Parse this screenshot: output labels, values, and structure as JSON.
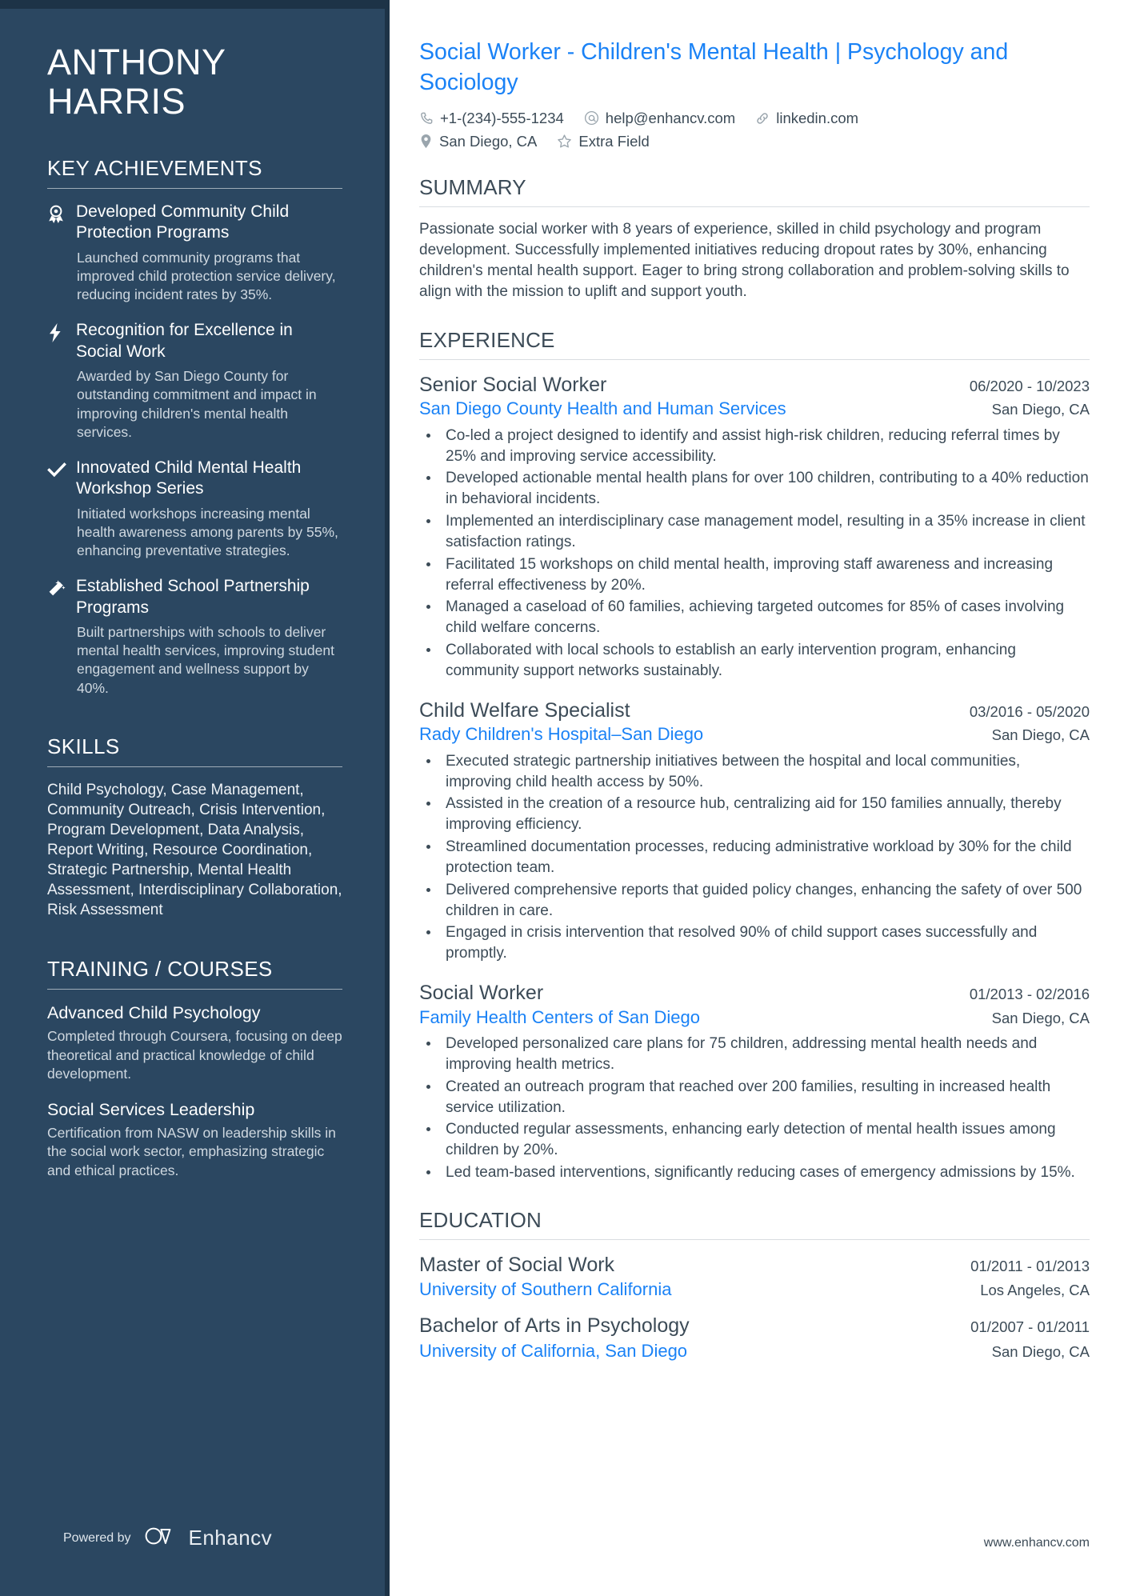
{
  "sidebar": {
    "name_first": "ANTHONY",
    "name_last": "HARRIS",
    "achievements_heading": "KEY ACHIEVEMENTS",
    "achievements": [
      {
        "icon": "award-ribbon-icon",
        "title": "Developed Community Child Protection Programs",
        "description": "Launched community programs that improved child protection service delivery, reducing incident rates by 35%."
      },
      {
        "icon": "lightning-bolt-icon",
        "title": "Recognition for Excellence in Social Work",
        "description": "Awarded by San Diego County for outstanding commitment and impact in improving children's mental health services."
      },
      {
        "icon": "checkmark-icon",
        "title": "Innovated Child Mental Health Workshop Series",
        "description": "Initiated workshops increasing mental health awareness among parents by 55%, enhancing preventative strategies."
      },
      {
        "icon": "magic-wand-icon",
        "title": "Established School Partnership Programs",
        "description": "Built partnerships with schools to deliver mental health services, improving student engagement and wellness support by 40%."
      }
    ],
    "skills_heading": "SKILLS",
    "skills_text": "Child Psychology, Case Management, Community Outreach, Crisis Intervention, Program Development, Data Analysis, Report Writing, Resource Coordination, Strategic Partnership, Mental Health Assessment, Interdisciplinary Collaboration, Risk Assessment",
    "training_heading": "TRAINING / COURSES",
    "courses": [
      {
        "title": "Advanced Child Psychology",
        "description": "Completed through Coursera, focusing on deep theoretical and practical knowledge of child development."
      },
      {
        "title": "Social Services Leadership",
        "description": "Certification from NASW on leadership skills in the social work sector, emphasizing strategic and ethical practices."
      }
    ],
    "powered_by_label": "Powered by",
    "brand_name": "Enhancv"
  },
  "header": {
    "headline": "Social Worker - Children's Mental Health | Psychology and Sociology",
    "contacts": [
      {
        "icon": "phone-icon",
        "text": "+1-(234)-555-1234"
      },
      {
        "icon": "at-email-icon",
        "text": "help@enhancv.com"
      },
      {
        "icon": "link-icon",
        "text": "linkedin.com"
      },
      {
        "icon": "map-pin-icon",
        "text": "San Diego, CA"
      },
      {
        "icon": "star-icon",
        "text": "Extra Field"
      }
    ]
  },
  "summary": {
    "heading": "SUMMARY",
    "text": "Passionate social worker with 8 years of experience, skilled in child psychology and program development. Successfully implemented initiatives reducing dropout rates by 30%, enhancing children's mental health support. Eager to bring strong collaboration and problem-solving skills to align with the mission to uplift and support youth."
  },
  "experience": {
    "heading": "EXPERIENCE",
    "jobs": [
      {
        "title": "Senior Social Worker",
        "date": "06/2020 - 10/2023",
        "organization": "San Diego County Health and Human Services",
        "location": "San Diego, CA",
        "bullets": [
          "Co-led a project designed to identify and assist high-risk children, reducing referral times by 25% and improving service accessibility.",
          "Developed actionable mental health plans for over 100 children, contributing to a 40% reduction in behavioral incidents.",
          "Implemented an interdisciplinary case management model, resulting in a 35% increase in client satisfaction ratings.",
          "Facilitated 15 workshops on child mental health, improving staff awareness and increasing referral effectiveness by 20%.",
          "Managed a caseload of 60 families, achieving targeted outcomes for 85% of cases involving child welfare concerns.",
          "Collaborated with local schools to establish an early intervention program, enhancing community support networks sustainably."
        ]
      },
      {
        "title": "Child Welfare Specialist",
        "date": "03/2016 - 05/2020",
        "organization": "Rady Children's Hospital–San Diego",
        "location": "San Diego, CA",
        "bullets": [
          "Executed strategic partnership initiatives between the hospital and local communities, improving child health access by 50%.",
          "Assisted in the creation of a resource hub, centralizing aid for 150 families annually, thereby improving efficiency.",
          "Streamlined documentation processes, reducing administrative workload by 30% for the child protection team.",
          "Delivered comprehensive reports that guided policy changes, enhancing the safety of over 500 children in care.",
          "Engaged in crisis intervention that resolved 90% of child support cases successfully and promptly."
        ]
      },
      {
        "title": "Social Worker",
        "date": "01/2013 - 02/2016",
        "organization": "Family Health Centers of San Diego",
        "location": "San Diego, CA",
        "bullets": [
          "Developed personalized care plans for 75 children, addressing mental health needs and improving health metrics.",
          "Created an outreach program that reached over 200 families, resulting in increased health service utilization.",
          "Conducted regular assessments, enhancing early detection of mental health issues among children by 20%.",
          "Led team-based interventions, significantly reducing cases of emergency admissions by 15%."
        ]
      }
    ]
  },
  "education": {
    "heading": "EDUCATION",
    "entries": [
      {
        "degree": "Master of Social Work",
        "date": "01/2011 - 01/2013",
        "school": "University of Southern California",
        "location": "Los Angeles, CA"
      },
      {
        "degree": "Bachelor of Arts in Psychology",
        "date": "01/2007 - 01/2011",
        "school": "University of California, San Diego",
        "location": "San Diego, CA"
      }
    ]
  },
  "footer": {
    "website": "www.enhancv.com"
  },
  "colors": {
    "sidebar_bg": "#2b4761",
    "sidebar_band": "#1d3347",
    "accent_blue": "#1a82f6",
    "body_text": "#3c4b57",
    "muted_text": "#cfd8e0"
  }
}
